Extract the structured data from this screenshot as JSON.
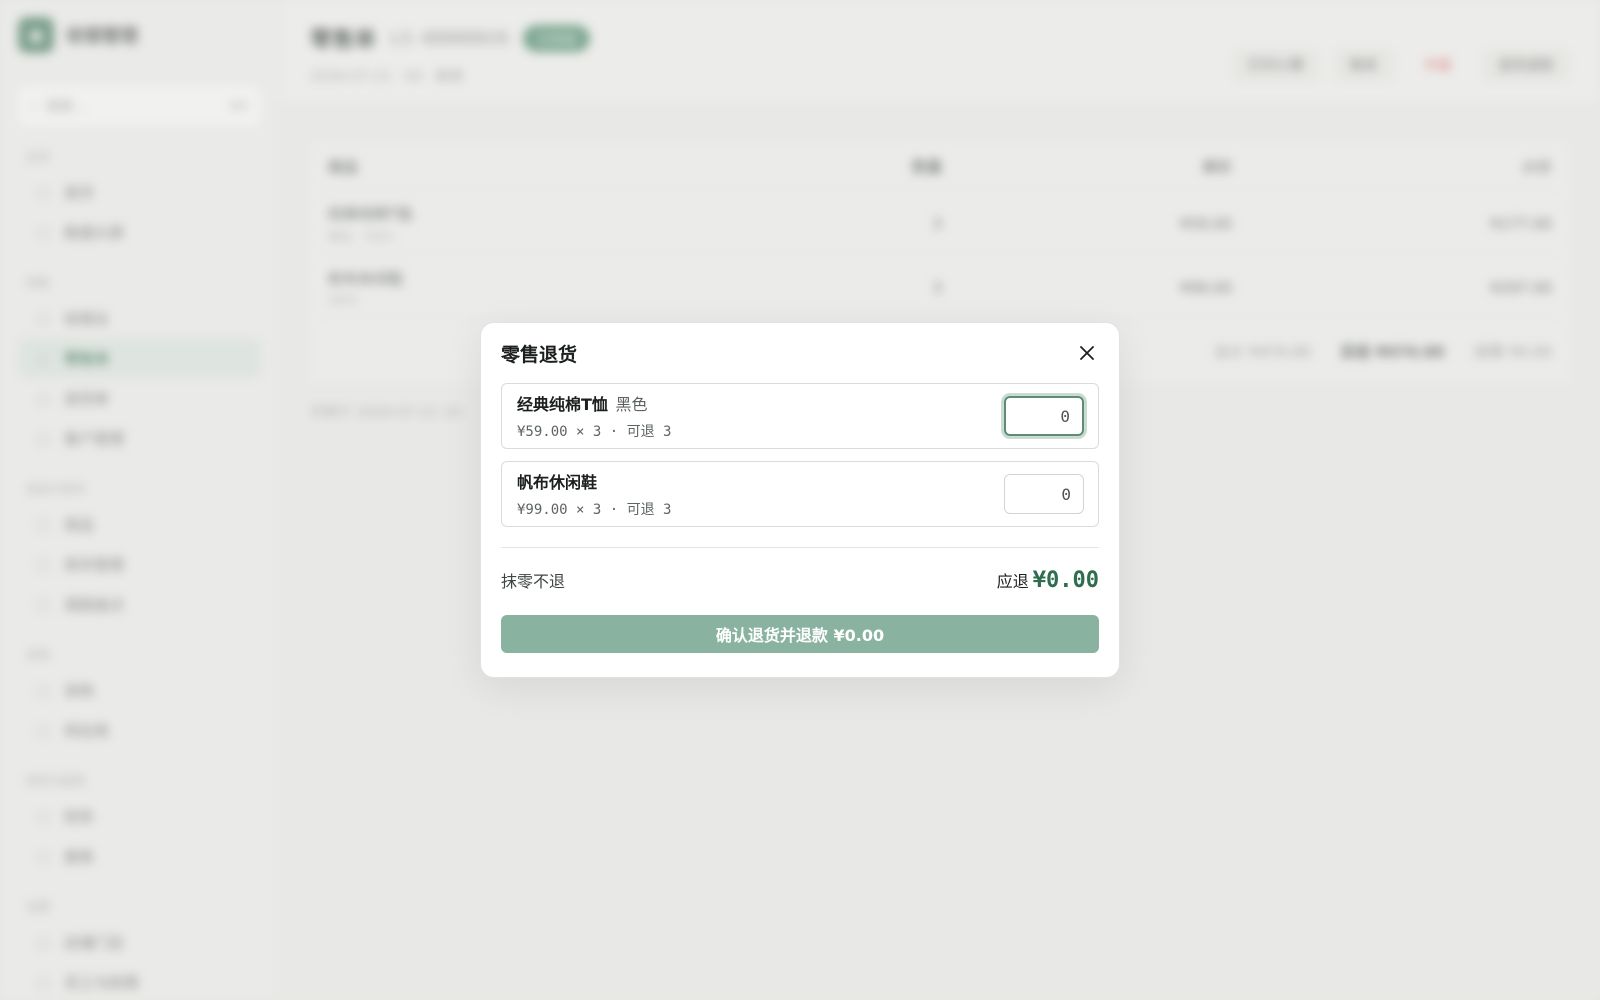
{
  "background": {
    "brand": {
      "name": "收银管理"
    },
    "sidebar": {
      "search_placeholder": "搜索...",
      "search_shortcut": "⌘K",
      "groups": [
        {
          "title": "总览",
          "items": [
            {
              "label": "首页"
            },
            {
              "label": "数据大屏"
            }
          ]
        },
        {
          "title": "销售",
          "items": [
            {
              "label": "收银台"
            },
            {
              "label": "零售单",
              "active": true
            },
            {
              "label": "退货单"
            },
            {
              "label": "客户管理"
            }
          ]
        },
        {
          "title": "商品与库存",
          "items": [
            {
              "label": "商品"
            },
            {
              "label": "库存管理"
            },
            {
              "label": "调拨盘点"
            }
          ]
        },
        {
          "title": "采购",
          "items": [
            {
              "label": "采购"
            },
            {
              "label": "供应商"
            }
          ]
        },
        {
          "title": "财务与报表",
          "items": [
            {
              "label": "财务"
            },
            {
              "label": "报表"
            }
          ]
        },
        {
          "title": "设置",
          "items": [
            {
              "label": "店铺门店"
            },
            {
              "label": "员工与权限"
            }
          ]
        }
      ]
    },
    "header": {
      "title": "零售单",
      "doc_no": "LS-00000026",
      "status": "已完成",
      "subtitle": "2026-07-21 · 04 · 散客",
      "actions": {
        "print": "打印小票",
        "call": "联系",
        "void": "作废",
        "refund": "退货退款"
      }
    },
    "table": {
      "headers": {
        "name": "商品",
        "qty": "数量",
        "price": "单价",
        "subtotal": "小计"
      },
      "rows": [
        {
          "name": "经典纯棉T恤",
          "sub": "黑色 · T001",
          "qty": "3",
          "price": "¥59.00",
          "subtotal": "¥177.00"
        },
        {
          "name": "帆布休闲鞋",
          "sub": "S001",
          "qty": "3",
          "price": "¥99.00",
          "subtotal": "¥297.00"
        }
      ],
      "footer": {
        "total": "合计 ¥474.00",
        "paid": "实收 ¥474.00",
        "change": "找零 ¥0.00"
      }
    },
    "remark": "开单于 2026-07-21 10:"
  },
  "modal": {
    "title": "零售退货",
    "items": [
      {
        "name": "经典纯棉T恤",
        "variant": "黑色",
        "meta": "¥59.00 × 3 · 可退 3",
        "qty": "0"
      },
      {
        "name": "帆布休闲鞋",
        "variant": "",
        "meta": "¥99.00 × 3 · 可退 3",
        "qty": "0"
      }
    ],
    "rounding_note": "抹零不退",
    "refund_label": "应退",
    "refund_amount": "¥0.00",
    "confirm_label": "确认退货并退款 ¥0.00"
  },
  "colors": {
    "accent": "#2f6d4f",
    "confirm_disabled": "#89b3a0",
    "focus_ring": "#5f8b78"
  }
}
